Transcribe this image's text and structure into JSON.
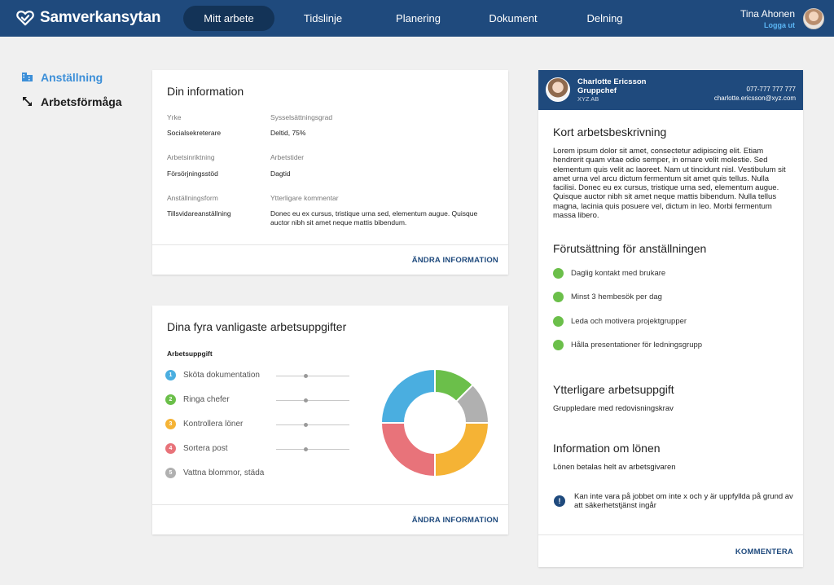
{
  "header": {
    "brand": "Samverkansytan",
    "nav": [
      "Mitt arbete",
      "Tidslinje",
      "Planering",
      "Dokument",
      "Delning"
    ],
    "active_nav": "Mitt arbete",
    "user_name": "Tina Ahonen",
    "logout": "Logga ut"
  },
  "sidebar": {
    "items": [
      {
        "label": "Anställning",
        "icon": "building-icon"
      },
      {
        "label": "Arbetsförmåga",
        "icon": "resize-arrow-icon"
      }
    ]
  },
  "info_card": {
    "title": "Din information",
    "fields": [
      {
        "label": "Yrke",
        "value": "Socialsekreterare"
      },
      {
        "label": "Sysselsättningsgrad",
        "value": "Deltid, 75%"
      },
      {
        "label": "Arbetsinriktning",
        "value": "Försörjningsstöd"
      },
      {
        "label": "Arbetstider",
        "value": "Dagtid"
      },
      {
        "label": "Anställningsform",
        "value": "Tillsvidareanställning"
      },
      {
        "label": "Ytterligare kommentar",
        "value": "Donec eu ex cursus, tristique urna sed, elementum augue. Quisque auctor nibh sit amet neque mattis bibendum."
      }
    ],
    "action": "ÄNDRA INFORMATION"
  },
  "tasks_card": {
    "title": "Dina fyra vanligaste arbetsuppgifter",
    "column_header": "Arbetsuppgift",
    "tasks": [
      {
        "num": "1",
        "label": "Sköta dokumentation",
        "color": "#4aaee0",
        "level": 0.4
      },
      {
        "num": "2",
        "label": "Ringa chefer",
        "color": "#6bbf4a",
        "level": 0.4
      },
      {
        "num": "3",
        "label": "Kontrollera löner",
        "color": "#f5b335",
        "level": 0.4
      },
      {
        "num": "4",
        "label": "Sortera post",
        "color": "#e8737a",
        "level": 0.4
      },
      {
        "num": "5",
        "label": "Vattna blommor, städa",
        "color": "#b0b0b0",
        "level": null
      }
    ],
    "action": "ÄNDRA INFORMATION"
  },
  "chart_data": {
    "type": "pie",
    "donut": true,
    "slices": [
      {
        "color": "#6bbf4a",
        "value": 12.5
      },
      {
        "color": "#b0b0b0",
        "value": 12.5
      },
      {
        "color": "#f5b335",
        "value": 25
      },
      {
        "color": "#e8737a",
        "value": 25
      },
      {
        "color": "#4aaee0",
        "value": 25
      }
    ]
  },
  "contact": {
    "name": "Charlotte Ericsson",
    "role": "Gruppchef",
    "company": "XYZ AB",
    "phone": "077-777 777 777",
    "email": "charlotte.ericsson@xyz.com"
  },
  "details": {
    "desc_title": "Kort arbetsbeskrivning",
    "desc_text": "Lorem ipsum dolor sit amet, consectetur adipiscing elit. Etiam hendrerit quam vitae odio semper, in ornare velit molestie. Sed elementum quis velit ac laoreet. Nam ut tincidunt nisl. Vestibulum sit amet urna vel arcu dictum fermentum sit amet quis tellus. Nulla facilisi. Donec eu ex cursus, tristique urna sed, elementum augue. Quisque auctor nibh sit amet neque mattis bibendum. Nulla tellus magna, lacinia quis posuere vel, dictum in leo. Morbi fermentum massa libero.",
    "req_title": "Förutsättning för anställningen",
    "requirements": [
      "Daglig kontakt med brukare",
      "Minst 3 hembesök per dag",
      "Leda och motivera projektgrupper",
      "Hålla presentationer för ledningsgrupp"
    ],
    "extra_title": "Ytterligare arbetsuppgift",
    "extra_text": "Gruppledare med redovisningskrav",
    "salary_title": "Information om lönen",
    "salary_text": "Lönen betalas helt av arbetsgivaren",
    "notice_icon": "!",
    "notice_text": "Kan inte vara på jobbet om inte x och y är uppfyllda på grund av att säkerhetstjänst ingår",
    "action": "KOMMENTERA"
  }
}
